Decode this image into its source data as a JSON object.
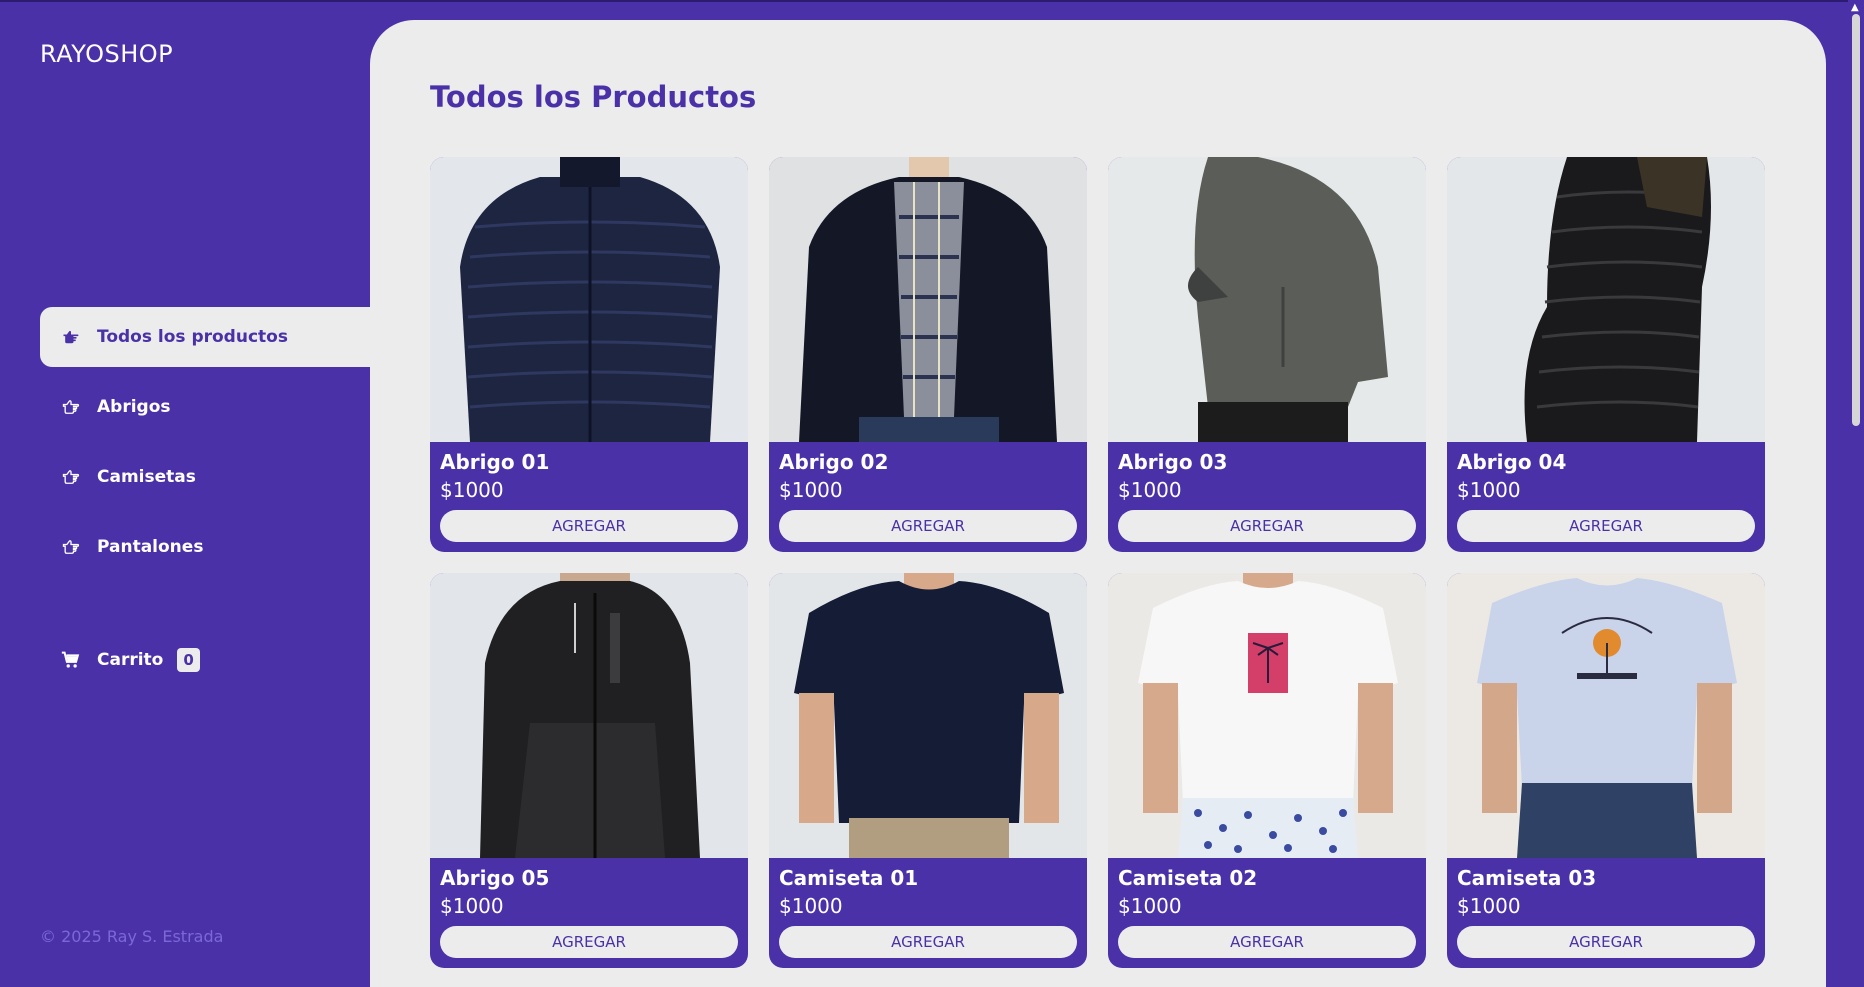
{
  "brand": "RAYOSHOP",
  "nav": {
    "items": [
      {
        "label": "Todos los productos",
        "icon": "hand-pointing-right-solid-icon",
        "active": true
      },
      {
        "label": "Abrigos",
        "icon": "hand-pointing-right-outline-icon",
        "active": false
      },
      {
        "label": "Camisetas",
        "icon": "hand-pointing-right-outline-icon",
        "active": false
      },
      {
        "label": "Pantalones",
        "icon": "hand-pointing-right-outline-icon",
        "active": false
      }
    ]
  },
  "cart": {
    "label": "Carrito",
    "count": "0",
    "icon": "cart-icon"
  },
  "footer": "© 2025 Ray S. Estrada",
  "main": {
    "title": "Todos los Productos"
  },
  "products": [
    {
      "name": "Abrigo 01",
      "price": "$1000",
      "button": "AGREGAR"
    },
    {
      "name": "Abrigo 02",
      "price": "$1000",
      "button": "AGREGAR"
    },
    {
      "name": "Abrigo 03",
      "price": "$1000",
      "button": "AGREGAR"
    },
    {
      "name": "Abrigo 04",
      "price": "$1000",
      "button": "AGREGAR"
    },
    {
      "name": "Abrigo 05",
      "price": "$1000",
      "button": "AGREGAR"
    },
    {
      "name": "Camiseta 01",
      "price": "$1000",
      "button": "AGREGAR"
    },
    {
      "name": "Camiseta 02",
      "price": "$1000",
      "button": "AGREGAR"
    },
    {
      "name": "Camiseta 03",
      "price": "$1000",
      "button": "AGREGAR"
    }
  ],
  "colors": {
    "brand_purple": "#4a31a8",
    "panel_gray": "#ececec",
    "footer_text": "#7b68d6"
  }
}
